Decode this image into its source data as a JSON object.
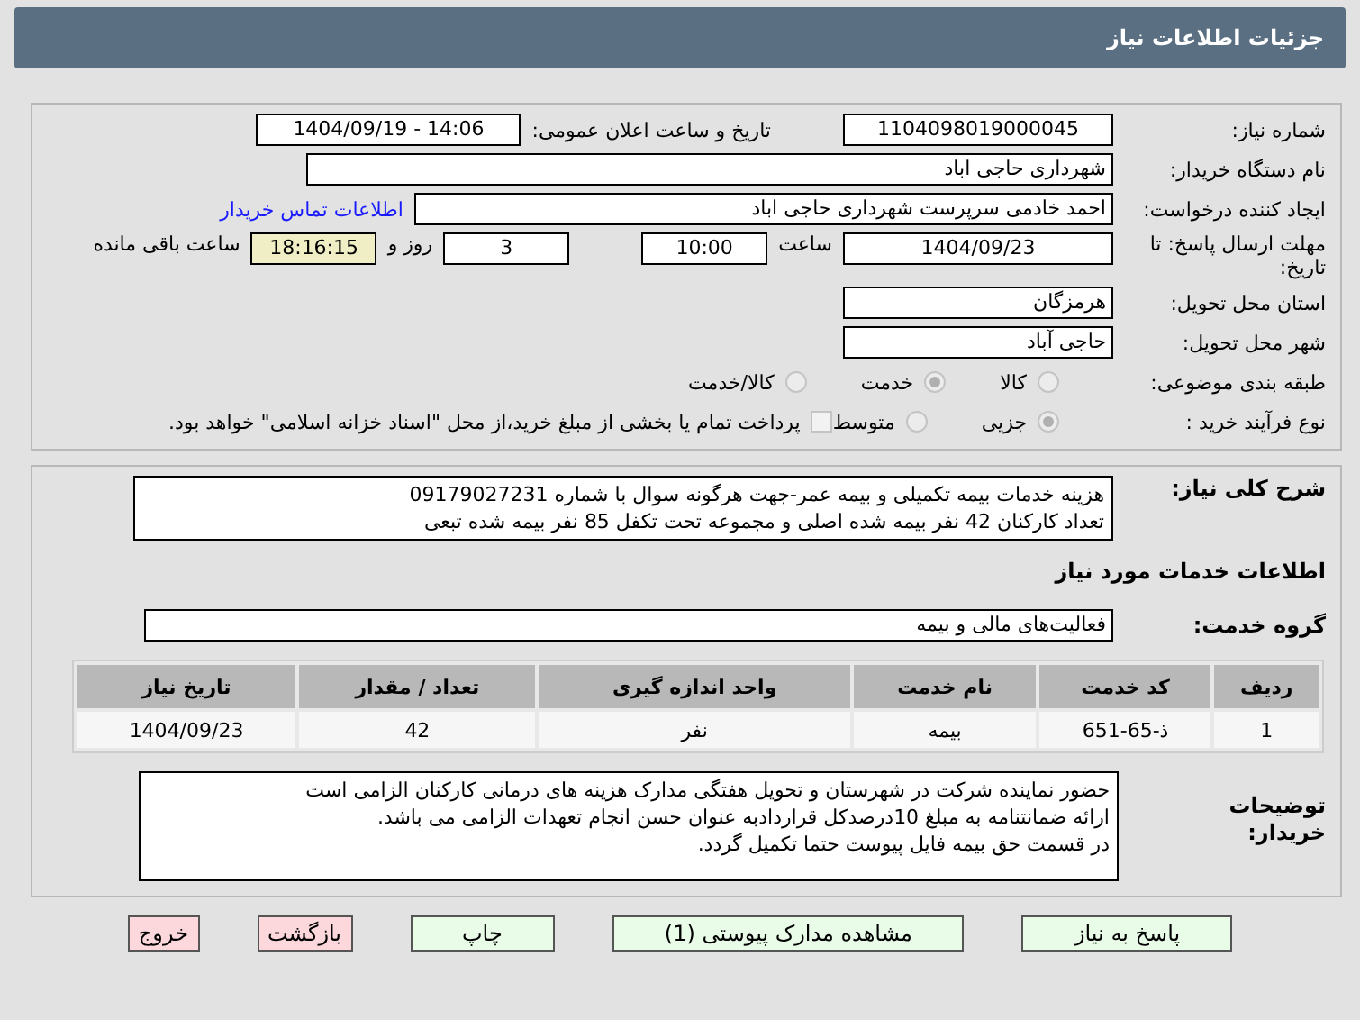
{
  "header": {
    "title": "جزئیات اطلاعات نیاز"
  },
  "need_number": {
    "label": "شماره نیاز:",
    "value": "1104098019000045"
  },
  "announce": {
    "label": "تاریخ و ساعت اعلان عمومی:",
    "value": "1404/09/19 - 14:06"
  },
  "buyer": {
    "label": "نام دستگاه خریدار:",
    "value": "شهرداری حاجی اباد"
  },
  "requester": {
    "label": "ایجاد کننده درخواست:",
    "value": "احمد خادمی سرپرست شهرداری حاجی اباد",
    "link": "اطلاعات تماس خریدار"
  },
  "deadline": {
    "label": "مهلت ارسال پاسخ: تا تاریخ:",
    "date": "1404/09/23",
    "time_label": "ساعت",
    "time": "10:00",
    "days": "3",
    "days_label": "روز و",
    "remaining": "18:16:15",
    "remaining_label": "ساعت باقی مانده"
  },
  "province": {
    "label": "استان محل تحویل:",
    "value": "هرمزگان"
  },
  "city": {
    "label": "شهر محل تحویل:",
    "value": "حاجی آباد"
  },
  "category": {
    "label": "طبقه بندی موضوعی:",
    "options": [
      {
        "label": "کالا",
        "selected": false
      },
      {
        "label": "خدمت",
        "selected": true
      },
      {
        "label": "کالا/خدمت",
        "selected": false
      }
    ]
  },
  "process": {
    "label": "نوع فرآیند خرید :",
    "options": [
      {
        "label": "جزیی",
        "selected": true
      },
      {
        "label": "متوسط",
        "selected": false
      }
    ],
    "payment": {
      "checked": false,
      "text": "پرداخت تمام یا بخشی از مبلغ خرید،از محل \"اسناد خزانه اسلامی\" خواهد بود."
    }
  },
  "description": {
    "label": "شرح کلی نیاز:",
    "lines": [
      "هزینه خدمات بیمه تکمیلی و بیمه عمر-جهت هرگونه سوال با شماره 09179027231",
      "تعداد کارکنان 42 نفر بیمه شده اصلی و مجموعه تحت تکفل  85 نفر بیمه شده تبعی"
    ]
  },
  "services_title": "اطلاعات خدمات مورد نیاز",
  "service_group": {
    "label": "گروه خدمت:",
    "value": "فعالیت‌های مالی و بیمه"
  },
  "table": {
    "columns": [
      "ردیف",
      "کد خدمت",
      "نام خدمت",
      "واحد اندازه گیری",
      "تعداد / مقدار",
      "تاریخ نیاز"
    ],
    "rows": [
      [
        "1",
        "ذ-65-651",
        "بیمه",
        "نفر",
        "42",
        "1404/09/23"
      ]
    ]
  },
  "notes": {
    "label": "توضیحات خریدار:",
    "lines": [
      "حضور نماینده شرکت در شهرستان و تحویل هفتگی مدارک هزینه های درمانی کارکنان الزامی است",
      "ارائه ضمانتنامه به مبلغ 10درصدکل قراردادبه عنوان حسن انجام تعهدات الزامی می باشد.",
      "در قسمت حق بیمه فایل پیوست حتما تکمیل گردد."
    ]
  },
  "buttons": [
    {
      "label": "پاسخ به نیاز",
      "kind": "green"
    },
    {
      "label": "مشاهده مدارک پیوستی (1)",
      "kind": "green"
    },
    {
      "label": "چاپ",
      "kind": "green"
    },
    {
      "label": "بازگشت",
      "kind": "red"
    },
    {
      "label": "خروج",
      "kind": "red"
    }
  ]
}
